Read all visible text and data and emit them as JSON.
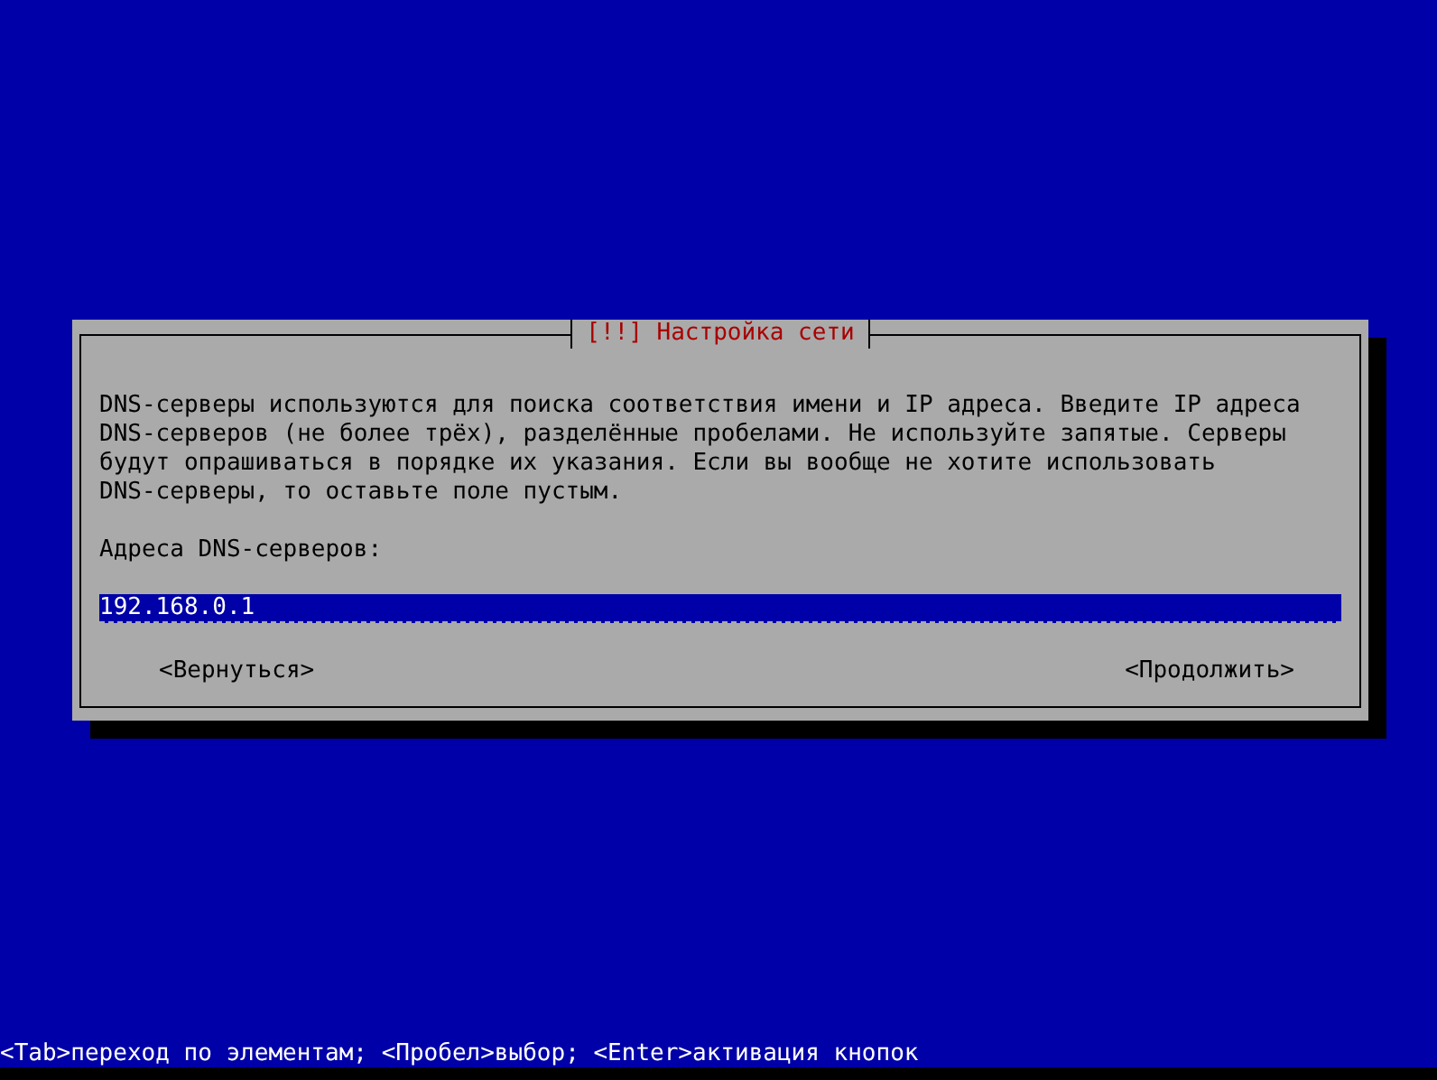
{
  "dialog": {
    "title": "[!!] Настройка сети",
    "description": "DNS-серверы используются для поиска соответствия имени и IP адреса. Введите IP адреса\nDNS-серверов (не более трёх), разделённые пробелами. Не используйте запятые. Серверы\nбудут опрашиваться в порядке их указания. Если вы вообще не хотите использовать\nDNS-серверы, то оставьте поле пустым.",
    "field_label": "Адреса DNS-серверов:",
    "field": {
      "value": "192.168.0.1",
      "focused": true
    },
    "buttons": [
      {
        "label": "<Вернуться>",
        "selected": false
      },
      {
        "label": "<Продолжить>",
        "selected": false
      }
    ]
  },
  "status_bar": "<Tab>переход по элементам; <Пробел>выбор; <Enter>активация кнопок"
}
